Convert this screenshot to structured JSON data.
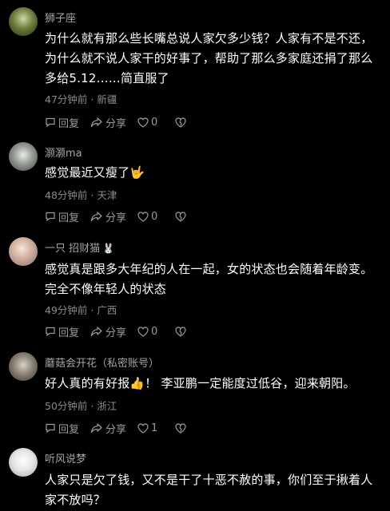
{
  "comments": [
    {
      "username": "狮子座",
      "badge": "",
      "lines": [
        "为什么就有那么些长嘴总说人家欠多少钱？人家有不是不还，",
        "为什么就不说人家干的好事了，帮助了那么多家庭还捐了那么",
        "多给5.12……简直服了"
      ],
      "time": "47分钟前",
      "location": "新疆",
      "reply_label": "回复",
      "share_label": "分享",
      "likes": "0"
    },
    {
      "username": "灏灏ma",
      "badge": "",
      "lines": [
        "感觉最近又瘦了🤟"
      ],
      "time": "48分钟前",
      "location": "天津",
      "reply_label": "回复",
      "share_label": "分享",
      "likes": "0"
    },
    {
      "username": "一只 招财猫",
      "badge": "🐰",
      "lines": [
        "感觉真是跟多大年纪的人在一起，女的状态也会随着年龄变。",
        "完全不像年轻人的状态"
      ],
      "time": "49分钟前",
      "location": "广西",
      "reply_label": "回复",
      "share_label": "分享",
      "likes": "0"
    },
    {
      "username": "蘑菇会开花（私密账号）",
      "badge": "",
      "lines": [
        "好人真的有好报👍！ 李亚鹏一定能度过低谷，迎来朝阳。"
      ],
      "time": "50分钟前",
      "location": "浙江",
      "reply_label": "回复",
      "share_label": "分享",
      "likes": "1"
    },
    {
      "username": "听风说梦",
      "badge": "",
      "lines": [
        "人家只是欠了钱，又不是干了十恶不赦的事，你们至于揪着人",
        "家不放吗？"
      ],
      "time": "",
      "location": "",
      "reply_label": "",
      "share_label": "",
      "likes": ""
    }
  ],
  "separator": "·"
}
